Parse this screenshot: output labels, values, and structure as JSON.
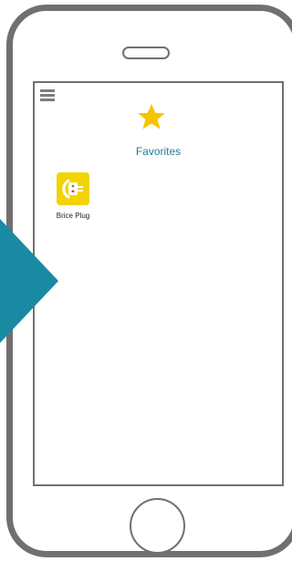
{
  "header": {
    "menu_icon": "hamburger-menu-icon",
    "favorites_icon": "star-icon",
    "title": "Favorites"
  },
  "favorites": [
    {
      "label": "Brice Plug",
      "icon": "smart-plug-icon"
    }
  ],
  "colors": {
    "accent": "#1e7f96",
    "star": "#f6c400",
    "device_tile": "#f1d400",
    "phone_frame": "#707070",
    "arrow": "#1a8aa3"
  }
}
